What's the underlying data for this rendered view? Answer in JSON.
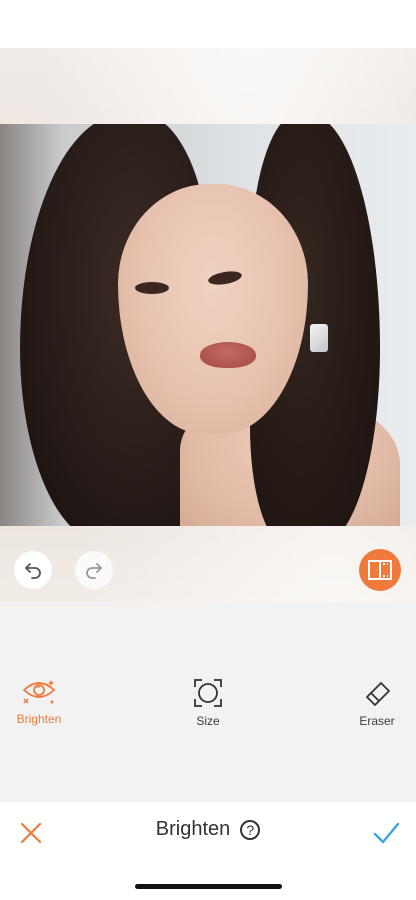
{
  "tools": {
    "brighten_label": "Brighten",
    "size_label": "Size",
    "eraser_label": "Eraser",
    "active": "Brighten"
  },
  "bottombar": {
    "title": "Brighten",
    "help_glyph": "?"
  },
  "icons": {
    "undo": "undo-icon",
    "redo": "redo-icon",
    "compare": "compare-icon",
    "brighten": "eye-sparkle-icon",
    "size": "resize-icon",
    "eraser": "eraser-icon",
    "cancel": "close-icon",
    "confirm": "checkmark-icon"
  },
  "colors": {
    "accent": "#ef7a3c",
    "confirm": "#3aa7e0",
    "toolbar_bg": "#f2f2f2",
    "text": "#333333"
  }
}
